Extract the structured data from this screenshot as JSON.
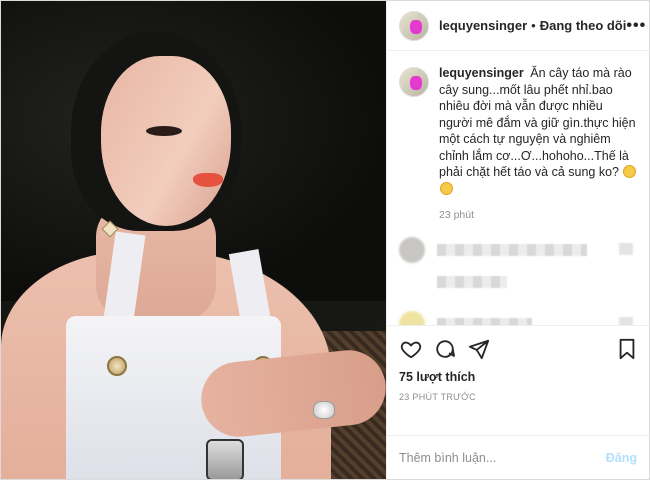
{
  "header": {
    "username": "lequyensinger",
    "separator": "•",
    "follow_status": "Đang theo dõi",
    "more_icon": "more-icon"
  },
  "caption": {
    "username": "lequyensinger",
    "text": "Ăn cây táo mà rào cây sung...mốt lâu phết nhỉ.bao nhiêu đời mà vẫn được nhiều người mê đắm và giữ gìn.thực hiện một cách tự nguyện và nghiêm chỉnh lắm cơ...Ơ...hohoho...Thế là phải chặt hết táo và cả sung ko?",
    "time": "23 phút"
  },
  "actions": {
    "like_icon": "heart-icon",
    "comment_icon": "comment-icon",
    "share_icon": "share-icon",
    "save_icon": "bookmark-icon",
    "likes": "75 lượt thích",
    "timestamp": "23 PHÚT TRƯỚC"
  },
  "add_comment": {
    "placeholder": "Thêm bình luận...",
    "post_label": "Đăng"
  },
  "colors": {
    "post_button_disabled": "#b2dffc",
    "muted_text": "#8e8e8e",
    "border": "#efefef"
  }
}
